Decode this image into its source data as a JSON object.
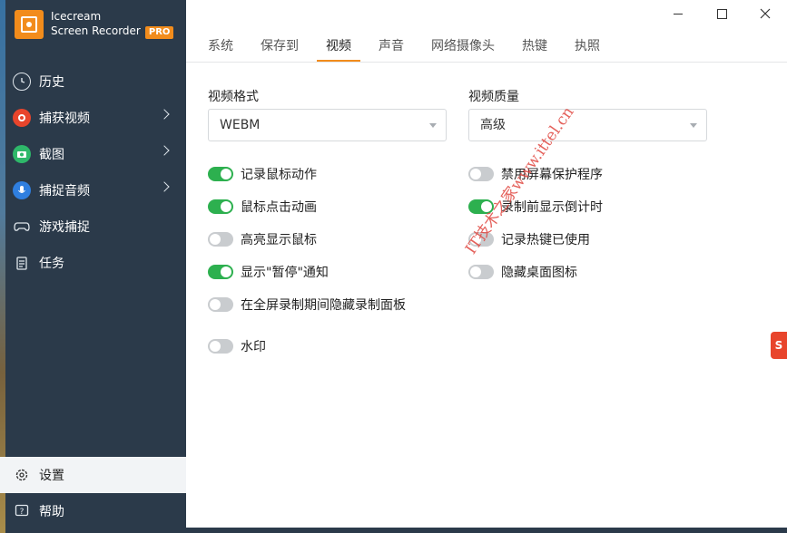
{
  "app": {
    "name_line1": "Icecream",
    "name_line2": "Screen Recorder",
    "badge": "PRO",
    "accent": "#f28c1c"
  },
  "sidebar": {
    "items": [
      {
        "label": "历史",
        "icon": "clock-icon"
      },
      {
        "label": "捕获视频",
        "icon": "record-icon"
      },
      {
        "label": "截图",
        "icon": "camera-icon"
      },
      {
        "label": "捕捉音频",
        "icon": "microphone-icon"
      },
      {
        "label": "游戏捕捉",
        "icon": "gamepad-icon"
      },
      {
        "label": "任务",
        "icon": "task-icon"
      }
    ],
    "bottom": [
      {
        "label": "设置",
        "icon": "gear-icon"
      },
      {
        "label": "帮助",
        "icon": "help-icon"
      }
    ]
  },
  "tabs": [
    "系统",
    "保存到",
    "视频",
    "声音",
    "网络摄像头",
    "热键",
    "执照"
  ],
  "active_tab": "视频",
  "video": {
    "format_label": "视频格式",
    "format_value": "WEBM",
    "quality_label": "视频质量",
    "quality_value": "高级"
  },
  "options_left": [
    {
      "label": "记录鼠标动作",
      "on": true
    },
    {
      "label": "鼠标点击动画",
      "on": true
    },
    {
      "label": "高亮显示鼠标",
      "on": false
    },
    {
      "label": "显示\"暂停\"通知",
      "on": true
    },
    {
      "label": "在全屏录制期间隐藏录制面板",
      "on": false
    },
    {
      "label": "水印",
      "on": false
    }
  ],
  "options_right": [
    {
      "label": "禁用屏幕保护程序",
      "on": false
    },
    {
      "label": "录制前显示倒计时",
      "on": true
    },
    {
      "label": "记录热键已使用",
      "on": false
    },
    {
      "label": "隐藏桌面图标",
      "on": false
    }
  ],
  "watermark_text": "IT技术之家www.ittel.cn",
  "side_badge": "S"
}
